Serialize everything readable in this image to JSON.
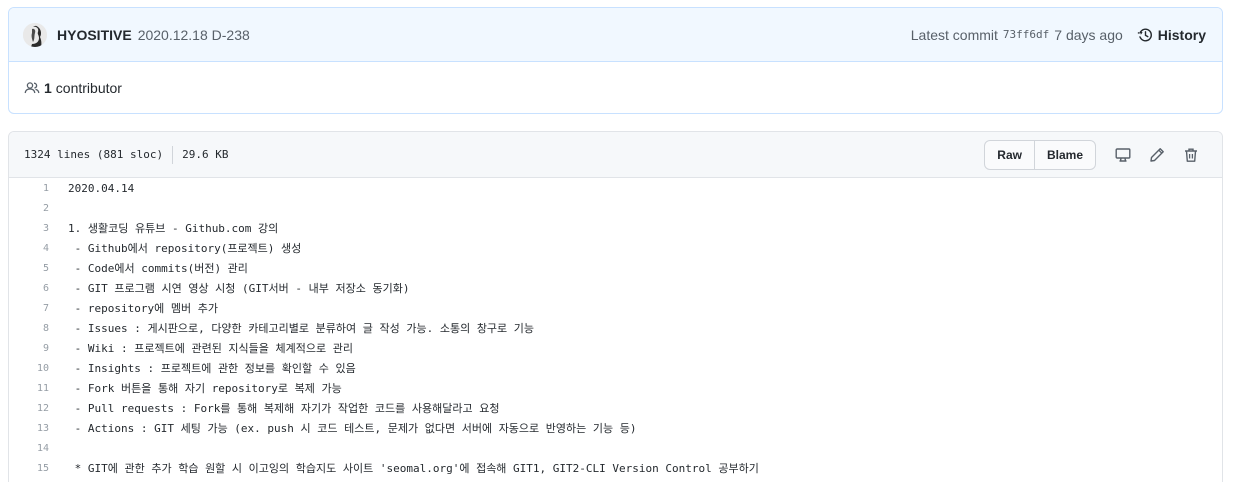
{
  "commit": {
    "author": "HYOSITIVE",
    "message": "2020.12.18 D-238",
    "latest_label": "Latest commit",
    "sha": "73ff6df",
    "ago": "7 days ago",
    "history_label": "History"
  },
  "contributors": {
    "count": "1",
    "label": "contributor"
  },
  "file": {
    "lines_info": "1324 lines (881 sloc)",
    "size": "29.6 KB",
    "raw_label": "Raw",
    "blame_label": "Blame"
  },
  "code_lines": [
    {
      "n": "1",
      "text": "2020.04.14"
    },
    {
      "n": "2",
      "text": ""
    },
    {
      "n": "3",
      "text": "1. 생활코딩 유튜브 - Github.com 강의"
    },
    {
      "n": "4",
      "text": " - Github에서 repository(프로젝트) 생성"
    },
    {
      "n": "5",
      "text": " - Code에서 commits(버전) 관리"
    },
    {
      "n": "6",
      "text": " - GIT 프로그램 시연 영상 시청 (GIT서버 - 내부 저장소 동기화)"
    },
    {
      "n": "7",
      "text": " - repository에 멤버 추가"
    },
    {
      "n": "8",
      "text": " - Issues : 게시판으로, 다양한 카테고리별로 분류하여 글 작성 가능. 소통의 창구로 기능"
    },
    {
      "n": "9",
      "text": " - Wiki : 프로젝트에 관련된 지식들을 체계적으로 관리"
    },
    {
      "n": "10",
      "text": " - Insights : 프로젝트에 관한 정보를 확인할 수 있음"
    },
    {
      "n": "11",
      "text": " - Fork 버튼을 통해 자기 repository로 복제 가능"
    },
    {
      "n": "12",
      "text": " - Pull requests : Fork를 통해 복제해 자기가 작업한 코드를 사용해달라고 요청"
    },
    {
      "n": "13",
      "text": " - Actions : GIT 세팅 가능 (ex. push 시 코드 테스트, 문제가 없다면 서버에 자동으로 반영하는 기능 등)"
    },
    {
      "n": "14",
      "text": ""
    },
    {
      "n": "15",
      "text": " * GIT에 관한 추가 학습 원할 시 이고잉의 학습지도 사이트 'seomal.org'에 접속해 GIT1, GIT2-CLI Version Control 공부하기"
    }
  ],
  "colors": {
    "commit_bg": "#f1f8ff",
    "commit_border": "#c8e1ff",
    "muted": "#586069"
  },
  "icons": [
    "avatar",
    "history-icon",
    "people-icon",
    "desktop-icon",
    "pencil-icon",
    "trash-icon"
  ]
}
